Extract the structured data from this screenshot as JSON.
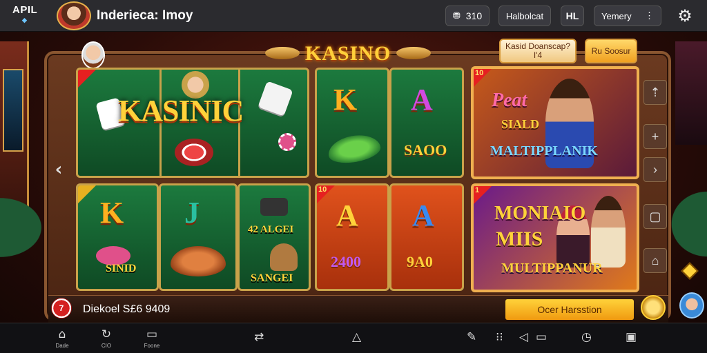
{
  "header": {
    "logo_text": "APIL",
    "title": "Inderieca: Imoy",
    "coins": "310",
    "balance_label": "Halbolcat",
    "hl_label": "HL",
    "account_label": "Yemery"
  },
  "main": {
    "banner": "KASINO",
    "signup_label": "Kasid Doanscap? I'4",
    "login_label": "Ru Soosur",
    "featured_title": "KASINIC",
    "tiles": {
      "k_green_top": "K",
      "a_green_top": "A",
      "value_green_top": "SAOO",
      "k_green_bottom": "K",
      "sind": "SINID",
      "j_green": "J",
      "alger_label": "42 ALGEI",
      "sangei": "SANGEI",
      "a_orange": "A",
      "value_orange_left": "2400",
      "a_blue": "A",
      "value_orange_right": "9A0",
      "badge_1": "1",
      "badge_2": "10",
      "badge_3": "10"
    },
    "promo_1": {
      "title": "Peat",
      "sub": "SIALD",
      "multi": "MALTIPPLANIK"
    },
    "promo_2": {
      "title": "MONIAIO",
      "sub": "MIIS",
      "multi": "MULTIPPANUR"
    }
  },
  "bottom": {
    "chip_label": "7",
    "info_text": "Diekoel S£6 9409",
    "cta_label": "Ocer Harsstion"
  },
  "bottomnav": {
    "items": [
      {
        "icon": "home-icon",
        "label": "Dade"
      },
      {
        "icon": "refresh-icon",
        "label": "CIO"
      },
      {
        "icon": "chat-icon",
        "label": "Foone"
      }
    ]
  },
  "colors": {
    "accent_gold": "#ffd23a",
    "frame_wood": "#6b3a20",
    "felt_green": "#1c7a3e",
    "cta_orange": "#f09a10"
  }
}
